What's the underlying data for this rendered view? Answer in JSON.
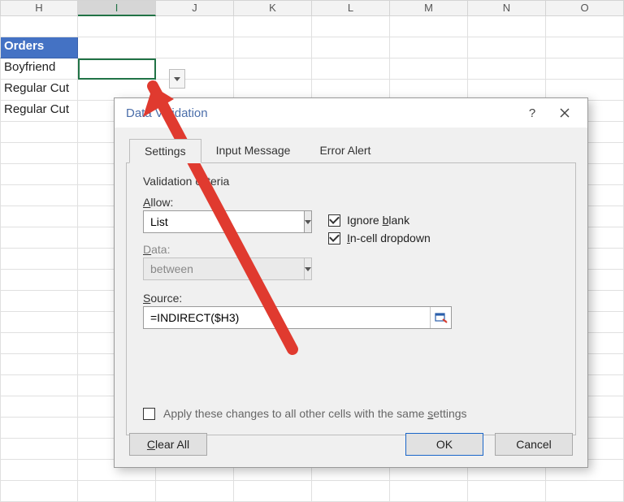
{
  "columns": [
    "H",
    "I",
    "J",
    "K",
    "L",
    "M",
    "N",
    "O"
  ],
  "selected_column": "I",
  "grid": {
    "orders_header": "Orders",
    "rows": [
      "Boyfriend",
      "Regular Cut",
      "Regular Cut"
    ]
  },
  "dialog": {
    "title": "Data Validation",
    "tabs": {
      "settings": "Settings",
      "input_msg": "Input Message",
      "error_alert": "Error Alert"
    },
    "criteria_label": "Validation criteria",
    "allow_label": "Allow:",
    "allow_value": "List",
    "data_label": "Data:",
    "data_value": "between",
    "ignore_blank": "Ignore blank",
    "incell_dropdown": "In-cell dropdown",
    "source_label": "Source:",
    "source_value": "=INDIRECT($H3)",
    "apply_label": "Apply these changes to all other cells with the same settings",
    "clear_all": "Clear All",
    "ok": "OK",
    "cancel": "Cancel"
  }
}
